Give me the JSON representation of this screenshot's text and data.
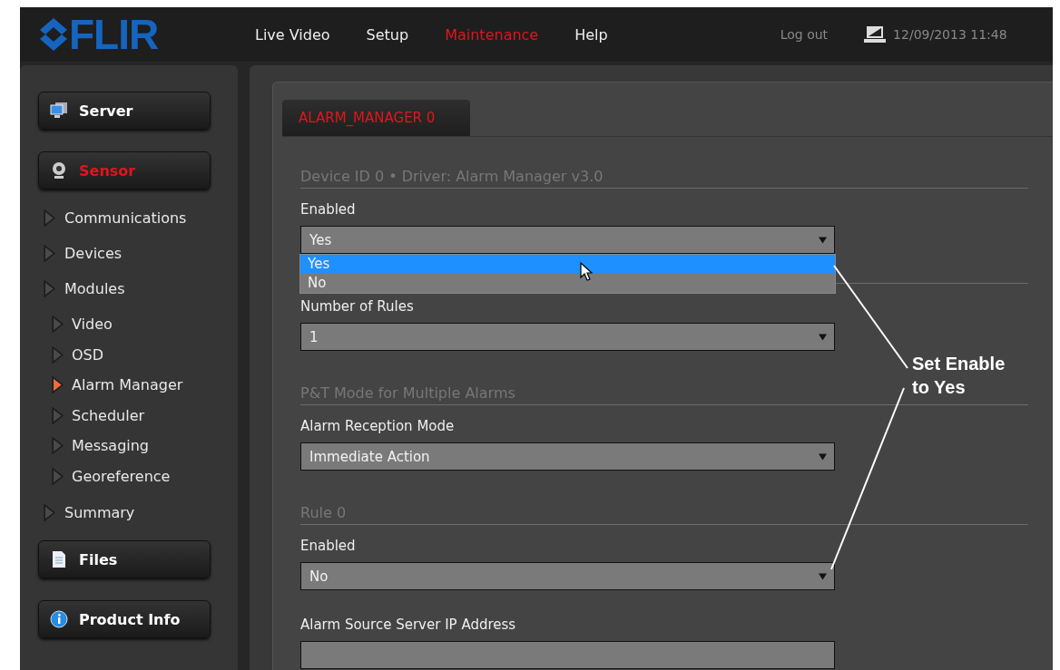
{
  "header": {
    "logo": "FLIR",
    "nav": [
      {
        "label": "Live Video",
        "selected": false
      },
      {
        "label": "Setup",
        "selected": false
      },
      {
        "label": "Maintenance",
        "selected": true
      },
      {
        "label": "Help",
        "selected": false
      }
    ],
    "logout": "Log out",
    "datetime": "12/09/2013 11:48"
  },
  "sidebar": {
    "items": [
      {
        "kind": "button",
        "label": "Server",
        "selected": false
      },
      {
        "kind": "button",
        "label": "Sensor",
        "selected": true
      },
      {
        "kind": "link",
        "label": "Communications",
        "selected": false
      },
      {
        "kind": "link",
        "label": "Devices",
        "selected": false
      },
      {
        "kind": "link",
        "label": "Modules",
        "selected": false,
        "children": [
          {
            "label": "Video",
            "selected": false
          },
          {
            "label": "OSD",
            "selected": false
          },
          {
            "label": "Alarm Manager",
            "selected": true
          },
          {
            "label": "Scheduler",
            "selected": false
          },
          {
            "label": "Messaging",
            "selected": false
          },
          {
            "label": "Georeference",
            "selected": false
          }
        ]
      },
      {
        "kind": "link",
        "label": "Summary",
        "selected": false
      },
      {
        "kind": "button",
        "label": "Files",
        "selected": false
      },
      {
        "kind": "button",
        "label": "Product Info",
        "selected": false
      }
    ]
  },
  "main": {
    "tabs": [
      {
        "label": "ALARM_MANAGER 0",
        "selected": true
      }
    ],
    "form": [
      {
        "kind": "section",
        "title": "Device ID 0 • Driver: Alarm Manager v3.0"
      },
      {
        "kind": "select",
        "label": "Enabled",
        "value": "Yes",
        "open": true,
        "options": [
          {
            "label": "Yes",
            "selected": true
          },
          {
            "label": "No",
            "selected": false
          }
        ]
      },
      {
        "kind": "rule"
      },
      {
        "kind": "select",
        "label": "Number of Rules",
        "value": "1"
      },
      {
        "kind": "section",
        "title": "P&T Mode for Multiple Alarms"
      },
      {
        "kind": "select",
        "label": "Alarm Reception Mode",
        "value": "Immediate Action"
      },
      {
        "kind": "section",
        "title": "Rule 0"
      },
      {
        "kind": "select",
        "label": "Enabled",
        "value": "No"
      },
      {
        "kind": "input",
        "label": "Alarm Source Server IP Address"
      }
    ]
  },
  "annotation": {
    "text": "Set Enable to Yes"
  }
}
